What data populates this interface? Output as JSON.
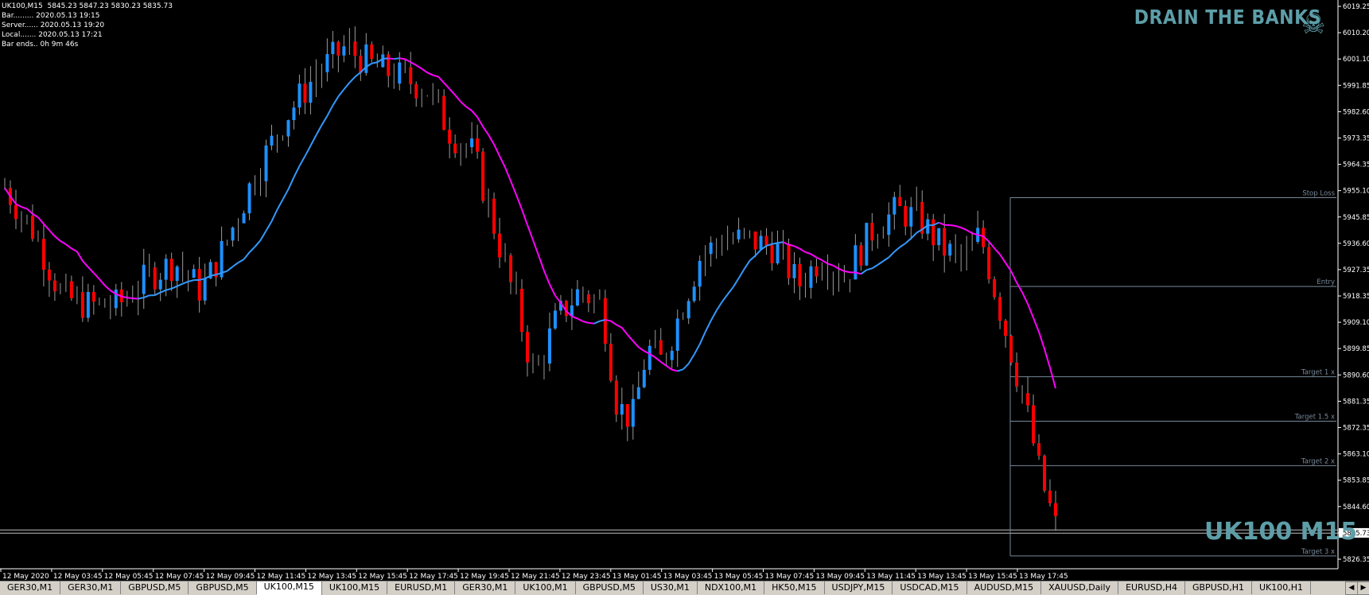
{
  "info": {
    "symbol_line": "UK100,M15  5845.23 5847.23 5830.23 5835.73",
    "bar_line": "Bar......... 2020.05.13 19:15",
    "server_line": "Server...... 2020.05.13 19:20",
    "local_line": "Local....... 2020.05.13 17:21",
    "bar_ends_line": "Bar ends.. 0h 9m 46s"
  },
  "brand": "DRAIN THE BANKS",
  "brand_icon": "skull-crossbones-icon",
  "symbol_label": "UK100 M15",
  "price_axis": {
    "labels": [
      "6019.25",
      "6010.20",
      "6001.10",
      "5991.85",
      "5982.60",
      "5973.35",
      "5964.35",
      "5955.10",
      "5945.85",
      "5936.60",
      "5927.35",
      "5918.35",
      "5909.10",
      "5899.85",
      "5890.60",
      "5881.35",
      "5872.35",
      "5863.10",
      "5853.85",
      "5844.60",
      "5835.73",
      "5826.35"
    ],
    "current_price": "5835.73"
  },
  "time_axis": {
    "labels": [
      "12 May 2020",
      "12 May 03:45",
      "12 May 05:45",
      "12 May 07:45",
      "12 May 09:45",
      "12 May 11:45",
      "12 May 13:45",
      "12 May 15:45",
      "12 May 17:45",
      "12 May 19:45",
      "12 May 21:45",
      "12 May 23:45",
      "13 May 01:45",
      "13 May 03:45",
      "13 May 05:45",
      "13 May 07:45",
      "13 May 09:45",
      "13 May 11:45",
      "13 May 13:45",
      "13 May 15:45",
      "13 May 17:45"
    ]
  },
  "levels": [
    {
      "label": "Stop Loss",
      "price": 5952.5
    },
    {
      "label": "Entry",
      "price": 5921.5
    },
    {
      "label": "Target 1 x",
      "price": 5890.0
    },
    {
      "label": "Target 1.5 x",
      "price": 5874.5
    },
    {
      "label": "Target 2 x",
      "price": 5859.0
    },
    {
      "label": "Target 3 x",
      "price": 5827.5
    }
  ],
  "colors": {
    "background": "#000000",
    "bull": "#1e90ff",
    "bear": "#ff0000",
    "ma_up": "#3399ff",
    "ma_down": "#ff00ff",
    "level_line": "#778899",
    "brand": "#5d9ea8",
    "axis_text": "#ffffff"
  },
  "chart_data": {
    "type": "candlestick",
    "symbol": "UK100",
    "timeframe": "M15",
    "ylim": [
      5826.35,
      6019.25
    ],
    "ohlc_approx": [
      [
        5958,
        5962,
        5945,
        5952
      ],
      [
        5952,
        5955,
        5930,
        5938
      ],
      [
        5938,
        5942,
        5920,
        5925
      ],
      [
        5925,
        5940,
        5918,
        5935
      ],
      [
        5935,
        5938,
        5920,
        5922
      ],
      [
        5922,
        5925,
        5905,
        5910
      ],
      [
        5910,
        5928,
        5906,
        5925
      ],
      [
        5925,
        5930,
        5912,
        5915
      ],
      [
        5915,
        5920,
        5905,
        5908
      ],
      [
        5908,
        5925,
        5906,
        5920
      ],
      [
        5920,
        5925,
        5908,
        5910
      ],
      [
        5910,
        5918,
        5905,
        5912
      ],
      [
        5912,
        5930,
        5910,
        5926
      ],
      [
        5926,
        5940,
        5922,
        5935
      ],
      [
        5935,
        5945,
        5928,
        5940
      ],
      [
        5940,
        5942,
        5920,
        5922
      ],
      [
        5922,
        5930,
        5915,
        5925
      ],
      [
        5925,
        5960,
        5922,
        5955
      ],
      [
        5955,
        5985,
        5950,
        5980
      ],
      [
        5980,
        5990,
        5962,
        5975
      ],
      [
        5975,
        5980,
        5950,
        5955
      ],
      [
        5955,
        5985,
        5952,
        5982
      ],
      [
        5982,
        5995,
        5975,
        5990
      ],
      [
        5990,
        5998,
        5980,
        5985
      ],
      [
        5985,
        6010,
        5982,
        6005
      ],
      [
        6005,
        6012,
        5985,
        5990
      ],
      [
        5990,
        6000,
        5975,
        5998
      ],
      [
        5998,
        6005,
        5990,
        5995
      ],
      [
        5995,
        6000,
        5985,
        5992
      ],
      [
        5992,
        5998,
        5978,
        5988
      ],
      [
        5988,
        5992,
        5965,
        5970
      ],
      [
        5970,
        5978,
        5955,
        5960
      ],
      [
        5960,
        5965,
        5935,
        5938
      ],
      [
        5938,
        5942,
        5908,
        5912
      ],
      [
        5912,
        5918,
        5880,
        5885
      ],
      [
        5885,
        5905,
        5880,
        5900
      ],
      [
        5900,
        5920,
        5895,
        5915
      ],
      [
        5915,
        5918,
        5890,
        5895
      ],
      [
        5895,
        5912,
        5892,
        5908
      ],
      [
        5908,
        5912,
        5875,
        5880
      ],
      [
        5880,
        5895,
        5865,
        5890
      ],
      [
        5890,
        5912,
        5888,
        5905
      ],
      [
        5905,
        5910,
        5895,
        5898
      ],
      [
        5898,
        5918,
        5894,
        5915
      ],
      [
        5915,
        5935,
        5910,
        5930
      ],
      [
        5930,
        5942,
        5925,
        5938
      ],
      [
        5938,
        5944,
        5930,
        5940
      ],
      [
        5940,
        5945,
        5928,
        5932
      ],
      [
        5932,
        5940,
        5918,
        5922
      ],
      [
        5922,
        5932,
        5905,
        5928
      ],
      [
        5928,
        5940,
        5922,
        5935
      ],
      [
        5935,
        5938,
        5918,
        5920
      ],
      [
        5920,
        5935,
        5915,
        5932
      ],
      [
        5932,
        5948,
        5928,
        5945
      ],
      [
        5945,
        5950,
        5935,
        5940
      ],
      [
        5940,
        5946,
        5928,
        5930
      ],
      [
        5930,
        5938,
        5925,
        5935
      ],
      [
        5935,
        5940,
        5920,
        5925
      ],
      [
        5925,
        5935,
        5915,
        5920
      ],
      [
        5920,
        5950,
        5918,
        5945
      ],
      [
        5945,
        5955,
        5920,
        5925
      ],
      [
        5925,
        5930,
        5900,
        5905
      ],
      [
        5905,
        5910,
        5875,
        5878
      ],
      [
        5878,
        5882,
        5855,
        5858
      ],
      [
        5858,
        5862,
        5835,
        5840
      ],
      [
        5840,
        5847,
        5830,
        5836
      ]
    ],
    "moving_average": "color-changing MA (blue rising, magenta falling)"
  },
  "tabs": [
    "GER30,M1",
    "GER30,M1",
    "GBPUSD,M5",
    "GBPUSD,M5",
    "UK100,M15",
    "UK100,M15",
    "EURUSD,M1",
    "GER30,M1",
    "UK100,M1",
    "GBPUSD,M5",
    "US30,M1",
    "NDX100,M1",
    "HK50,M15",
    "USDJPY,M15",
    "USDCAD,M15",
    "AUDUSD,M15",
    "XAUUSD,Daily",
    "EURUSD,H4",
    "GBPUSD,H1",
    "UK100,H1"
  ],
  "active_tab": 4
}
